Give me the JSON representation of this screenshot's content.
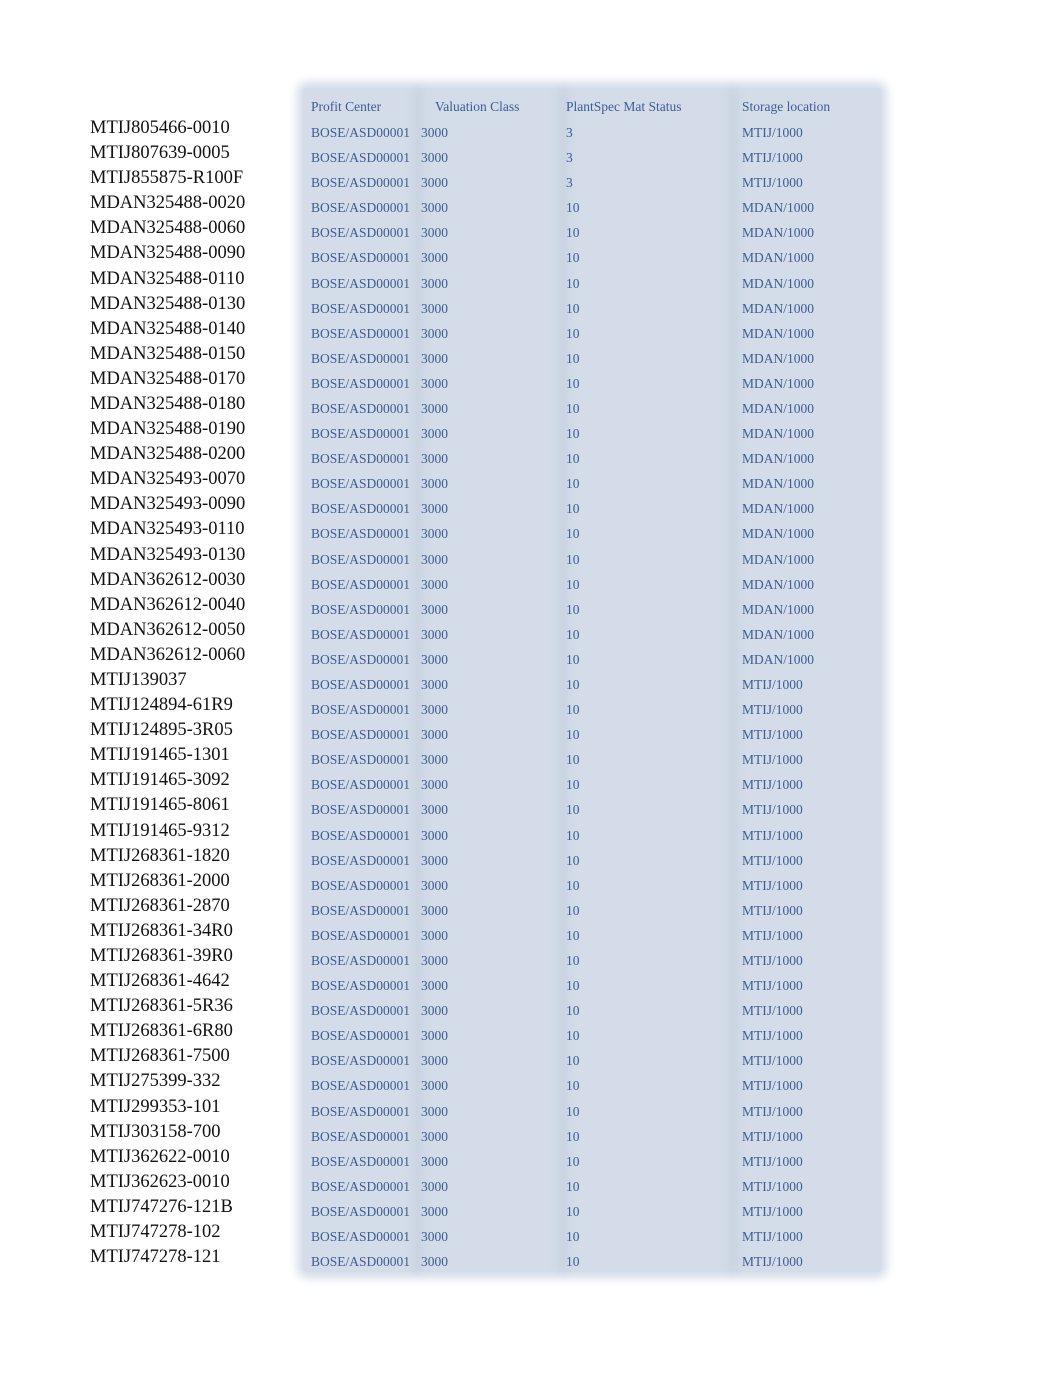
{
  "headers": {
    "profit_center": "Profit Center",
    "valuation_class": "Valuation Class",
    "plant_status": "PlantSpec Mat Status",
    "storage_location": "Storage location"
  },
  "rows": [
    {
      "material": "MTIJ805466-0010",
      "profit": "BOSE/ASD00001",
      "valuation": "3000",
      "status": "3",
      "storage": "MTIJ/1000"
    },
    {
      "material": "MTIJ807639-0005",
      "profit": "BOSE/ASD00001",
      "valuation": "3000",
      "status": "3",
      "storage": "MTIJ/1000"
    },
    {
      "material": "MTIJ855875-R100F",
      "profit": "BOSE/ASD00001",
      "valuation": "3000",
      "status": "3",
      "storage": "MTIJ/1000"
    },
    {
      "material": "MDAN325488-0020",
      "profit": "BOSE/ASD00001",
      "valuation": "3000",
      "status": "10",
      "storage": "MDAN/1000"
    },
    {
      "material": "MDAN325488-0060",
      "profit": "BOSE/ASD00001",
      "valuation": "3000",
      "status": "10",
      "storage": "MDAN/1000"
    },
    {
      "material": "MDAN325488-0090",
      "profit": "BOSE/ASD00001",
      "valuation": "3000",
      "status": "10",
      "storage": "MDAN/1000"
    },
    {
      "material": "MDAN325488-0110",
      "profit": "BOSE/ASD00001",
      "valuation": "3000",
      "status": "10",
      "storage": "MDAN/1000"
    },
    {
      "material": "MDAN325488-0130",
      "profit": "BOSE/ASD00001",
      "valuation": "3000",
      "status": "10",
      "storage": "MDAN/1000"
    },
    {
      "material": "MDAN325488-0140",
      "profit": "BOSE/ASD00001",
      "valuation": "3000",
      "status": "10",
      "storage": "MDAN/1000"
    },
    {
      "material": "MDAN325488-0150",
      "profit": "BOSE/ASD00001",
      "valuation": "3000",
      "status": "10",
      "storage": "MDAN/1000"
    },
    {
      "material": "MDAN325488-0170",
      "profit": "BOSE/ASD00001",
      "valuation": "3000",
      "status": "10",
      "storage": "MDAN/1000"
    },
    {
      "material": "MDAN325488-0180",
      "profit": "BOSE/ASD00001",
      "valuation": "3000",
      "status": "10",
      "storage": "MDAN/1000"
    },
    {
      "material": "MDAN325488-0190",
      "profit": "BOSE/ASD00001",
      "valuation": "3000",
      "status": "10",
      "storage": "MDAN/1000"
    },
    {
      "material": "MDAN325488-0200",
      "profit": "BOSE/ASD00001",
      "valuation": "3000",
      "status": "10",
      "storage": "MDAN/1000"
    },
    {
      "material": "MDAN325493-0070",
      "profit": "BOSE/ASD00001",
      "valuation": "3000",
      "status": "10",
      "storage": "MDAN/1000"
    },
    {
      "material": "MDAN325493-0090",
      "profit": "BOSE/ASD00001",
      "valuation": "3000",
      "status": "10",
      "storage": "MDAN/1000"
    },
    {
      "material": "MDAN325493-0110",
      "profit": "BOSE/ASD00001",
      "valuation": "3000",
      "status": "10",
      "storage": "MDAN/1000"
    },
    {
      "material": "MDAN325493-0130",
      "profit": "BOSE/ASD00001",
      "valuation": "3000",
      "status": "10",
      "storage": "MDAN/1000"
    },
    {
      "material": "MDAN362612-0030",
      "profit": "BOSE/ASD00001",
      "valuation": "3000",
      "status": "10",
      "storage": "MDAN/1000"
    },
    {
      "material": "MDAN362612-0040",
      "profit": "BOSE/ASD00001",
      "valuation": "3000",
      "status": "10",
      "storage": "MDAN/1000"
    },
    {
      "material": "MDAN362612-0050",
      "profit": "BOSE/ASD00001",
      "valuation": "3000",
      "status": "10",
      "storage": "MDAN/1000"
    },
    {
      "material": "MDAN362612-0060",
      "profit": "BOSE/ASD00001",
      "valuation": "3000",
      "status": "10",
      "storage": "MDAN/1000"
    },
    {
      "material": "MTIJ139037",
      "profit": "BOSE/ASD00001",
      "valuation": "3000",
      "status": "10",
      "storage": "MTIJ/1000"
    },
    {
      "material": "MTIJ124894-61R9",
      "profit": "BOSE/ASD00001",
      "valuation": "3000",
      "status": "10",
      "storage": "MTIJ/1000"
    },
    {
      "material": "MTIJ124895-3R05",
      "profit": "BOSE/ASD00001",
      "valuation": "3000",
      "status": "10",
      "storage": "MTIJ/1000"
    },
    {
      "material": "MTIJ191465-1301",
      "profit": "BOSE/ASD00001",
      "valuation": "3000",
      "status": "10",
      "storage": "MTIJ/1000"
    },
    {
      "material": "MTIJ191465-3092",
      "profit": "BOSE/ASD00001",
      "valuation": "3000",
      "status": "10",
      "storage": "MTIJ/1000"
    },
    {
      "material": "MTIJ191465-8061",
      "profit": "BOSE/ASD00001",
      "valuation": "3000",
      "status": "10",
      "storage": "MTIJ/1000"
    },
    {
      "material": "MTIJ191465-9312",
      "profit": "BOSE/ASD00001",
      "valuation": "3000",
      "status": "10",
      "storage": "MTIJ/1000"
    },
    {
      "material": "MTIJ268361-1820",
      "profit": "BOSE/ASD00001",
      "valuation": "3000",
      "status": "10",
      "storage": "MTIJ/1000"
    },
    {
      "material": "MTIJ268361-2000",
      "profit": "BOSE/ASD00001",
      "valuation": "3000",
      "status": "10",
      "storage": "MTIJ/1000"
    },
    {
      "material": "MTIJ268361-2870",
      "profit": "BOSE/ASD00001",
      "valuation": "3000",
      "status": "10",
      "storage": "MTIJ/1000"
    },
    {
      "material": "MTIJ268361-34R0",
      "profit": "BOSE/ASD00001",
      "valuation": "3000",
      "status": "10",
      "storage": "MTIJ/1000"
    },
    {
      "material": "MTIJ268361-39R0",
      "profit": "BOSE/ASD00001",
      "valuation": "3000",
      "status": "10",
      "storage": "MTIJ/1000"
    },
    {
      "material": "MTIJ268361-4642",
      "profit": "BOSE/ASD00001",
      "valuation": "3000",
      "status": "10",
      "storage": "MTIJ/1000"
    },
    {
      "material": "MTIJ268361-5R36",
      "profit": "BOSE/ASD00001",
      "valuation": "3000",
      "status": "10",
      "storage": "MTIJ/1000"
    },
    {
      "material": "MTIJ268361-6R80",
      "profit": "BOSE/ASD00001",
      "valuation": "3000",
      "status": "10",
      "storage": "MTIJ/1000"
    },
    {
      "material": "MTIJ268361-7500",
      "profit": "BOSE/ASD00001",
      "valuation": "3000",
      "status": "10",
      "storage": "MTIJ/1000"
    },
    {
      "material": "MTIJ275399-332",
      "profit": "BOSE/ASD00001",
      "valuation": "3000",
      "status": "10",
      "storage": "MTIJ/1000"
    },
    {
      "material": "MTIJ299353-101",
      "profit": "BOSE/ASD00001",
      "valuation": "3000",
      "status": "10",
      "storage": "MTIJ/1000"
    },
    {
      "material": "MTIJ303158-700",
      "profit": "BOSE/ASD00001",
      "valuation": "3000",
      "status": "10",
      "storage": "MTIJ/1000"
    },
    {
      "material": "MTIJ362622-0010",
      "profit": "BOSE/ASD00001",
      "valuation": "3000",
      "status": "10",
      "storage": "MTIJ/1000"
    },
    {
      "material": "MTIJ362623-0010",
      "profit": "BOSE/ASD00001",
      "valuation": "3000",
      "status": "10",
      "storage": "MTIJ/1000"
    },
    {
      "material": "MTIJ747276-121B",
      "profit": "BOSE/ASD00001",
      "valuation": "3000",
      "status": "10",
      "storage": "MTIJ/1000"
    },
    {
      "material": "MTIJ747278-102",
      "profit": "BOSE/ASD00001",
      "valuation": "3000",
      "status": "10",
      "storage": "MTIJ/1000"
    },
    {
      "material": "MTIJ747278-121",
      "profit": "BOSE/ASD00001",
      "valuation": "3000",
      "status": "10",
      "storage": "MTIJ/1000"
    }
  ]
}
